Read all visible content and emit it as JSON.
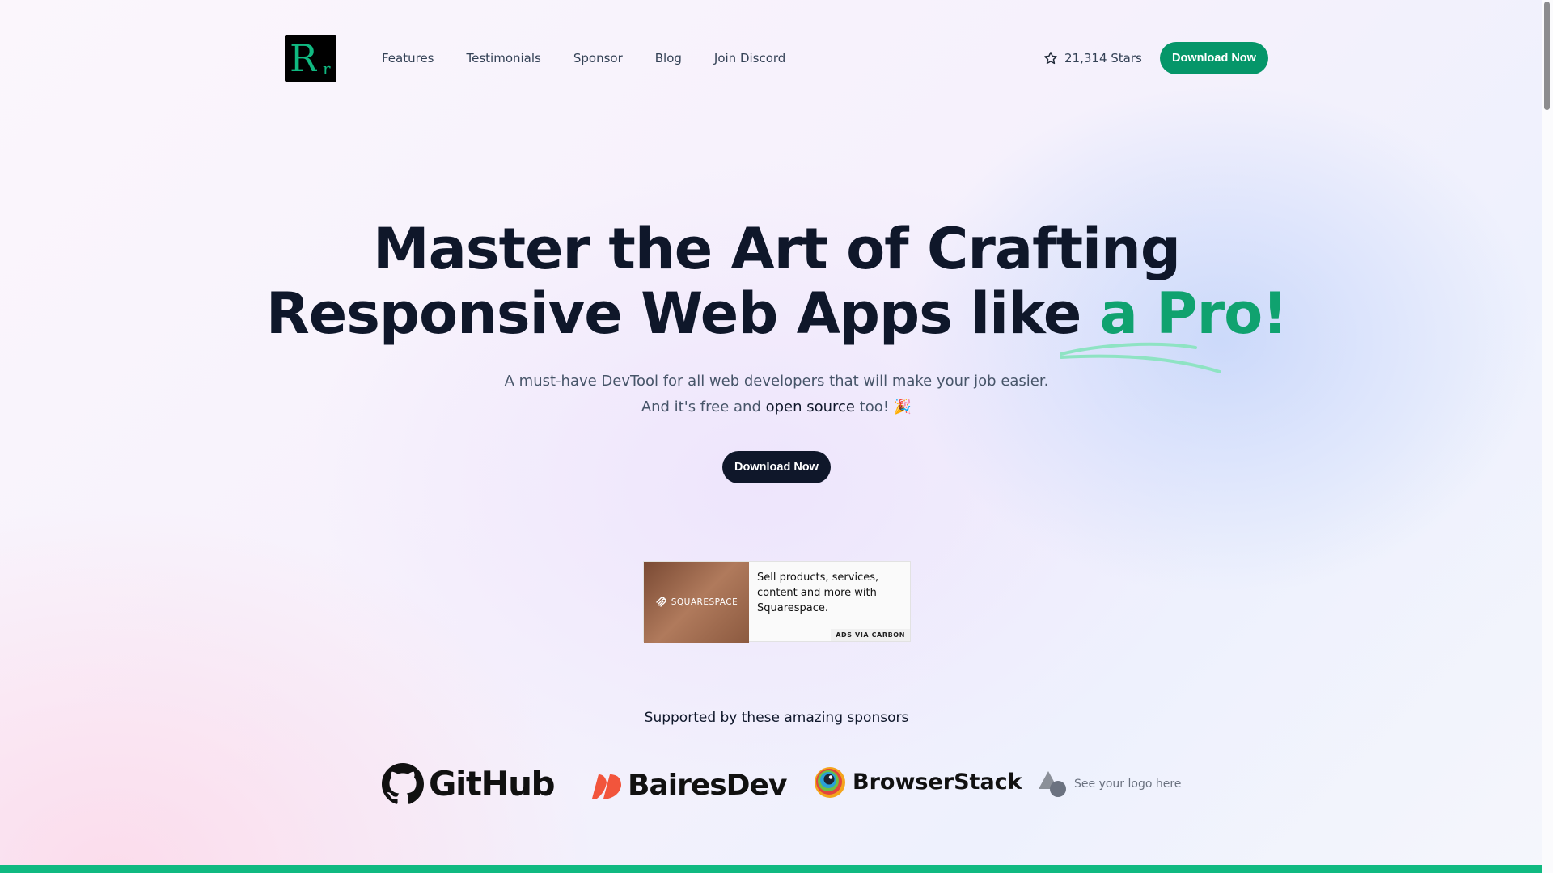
{
  "header": {
    "logo_letter_big": "R",
    "logo_letter_small": "r",
    "nav": [
      "Features",
      "Testimonials",
      "Sponsor",
      "Blog",
      "Join Discord"
    ],
    "stars_label": "21,314 Stars",
    "download_label": "Download Now"
  },
  "hero": {
    "title_line1": "Master the Art of Crafting",
    "title_line2_prefix": "Responsive Web Apps like ",
    "title_highlight": "a Pro!",
    "subtitle_line1": "A must-have DevTool for all web developers that will make your job easier.",
    "subtitle_line2_prefix": "And it's free and ",
    "subtitle_line2_strong": "open source",
    "subtitle_line2_suffix": " too! 🎉",
    "cta_label": "Download Now"
  },
  "ad": {
    "brand": "SQUARESPACE",
    "text": "Sell products, services, content and more with Squarespace.",
    "via": "ADS VIA CARBON"
  },
  "sponsors": {
    "title": "Supported by these amazing sponsors",
    "items": [
      "GitHub",
      "BairesDev",
      "BrowserStack"
    ],
    "placeholder": "See your logo here"
  },
  "colors": {
    "accent": "#059669",
    "highlight": "#10a26f",
    "dark": "#0f172a"
  },
  "icons": [
    "star-icon",
    "github-icon",
    "bairesdev-icon",
    "browserstack-icon",
    "logo-placeholder-icon",
    "squarespace-icon"
  ]
}
